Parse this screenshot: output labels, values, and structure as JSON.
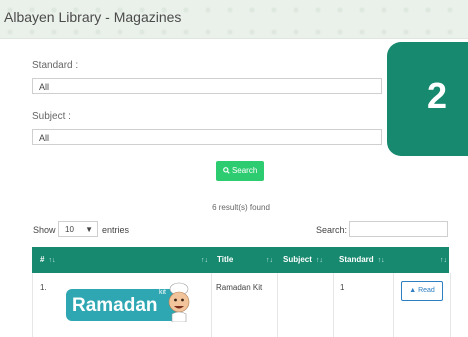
{
  "header": {
    "title": "Albayen Library - Magazines"
  },
  "filters": {
    "standard": {
      "label": "Standard :",
      "value": "All"
    },
    "subject": {
      "label": "Subject :",
      "value": "All"
    },
    "search_button": {
      "icon": "search-icon",
      "label": "Search"
    }
  },
  "results_text": "6 result(s) found",
  "datatable": {
    "length": {
      "prefix": "Show",
      "value": "10",
      "suffix": "entries"
    },
    "search_label": "Search:",
    "columns": [
      "#",
      "Title",
      "Subject",
      "Standard"
    ],
    "rows": [
      {
        "num": "1.",
        "cover_text": "Ramadan",
        "cover_subtext": "kit",
        "title": "Ramadan Kit",
        "subject": "",
        "standard": "1",
        "action": "Read"
      }
    ]
  },
  "overlay_badge": "2",
  "colors": {
    "header_green": "#16896f",
    "search_btn": "#2ecc71",
    "read_btn": "#2d7fc1",
    "cover_bg": "#2ea7b3"
  }
}
